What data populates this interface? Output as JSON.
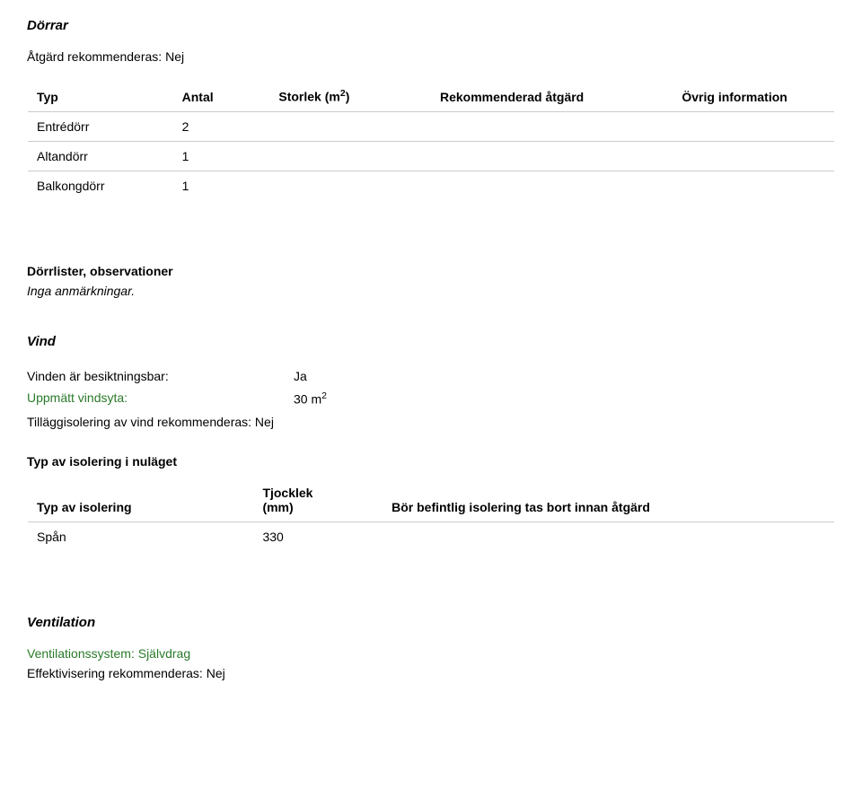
{
  "dorrar": {
    "title": "Dörrar",
    "atgard_label": "Åtgärd rekommenderas: ",
    "atgard_value": "Nej",
    "headers": {
      "typ": "Typ",
      "antal": "Antal",
      "storlek_pre": "Storlek (m",
      "storlek_sup": "2",
      "storlek_post": ")",
      "rekommenderad": "Rekommenderad åtgärd",
      "ovrig": "Övrig information"
    },
    "rows": [
      {
        "typ": "Entrédörr",
        "antal": "2",
        "storlek": "",
        "rek": "",
        "ovr": ""
      },
      {
        "typ": "Altandörr",
        "antal": "1",
        "storlek": "",
        "rek": "",
        "ovr": ""
      },
      {
        "typ": "Balkongdörr",
        "antal": "1",
        "storlek": "",
        "rek": "",
        "ovr": ""
      }
    ]
  },
  "dorrlister": {
    "title": "Dörrlister, observationer",
    "text": "Inga anmärkningar."
  },
  "vind": {
    "title": "Vind",
    "besikt_label": "Vinden är besiktningsbar:",
    "besikt_value": "Ja",
    "uppmatt_label": "Uppmätt vindsyta:",
    "uppmatt_value_pre": "30 m",
    "uppmatt_value_sup": "2",
    "tillagg_line": "Tilläggisolering av vind rekommenderas: Nej",
    "iso_heading": "Typ av isolering i nuläget",
    "iso_headers": {
      "typ": "Typ av isolering",
      "tjocklek_l1": "Tjocklek",
      "tjocklek_l2": "(mm)",
      "bor": "Bör befintlig isolering tas bort innan åtgärd"
    },
    "iso_rows": [
      {
        "typ": "Spån",
        "tjocklek": "330",
        "bor": ""
      }
    ]
  },
  "ventilation": {
    "title": "Ventilation",
    "sys_label": "Ventilationssystem: ",
    "sys_value": "Självdrag",
    "eff_line": "Effektivisering rekommenderas: Nej"
  }
}
